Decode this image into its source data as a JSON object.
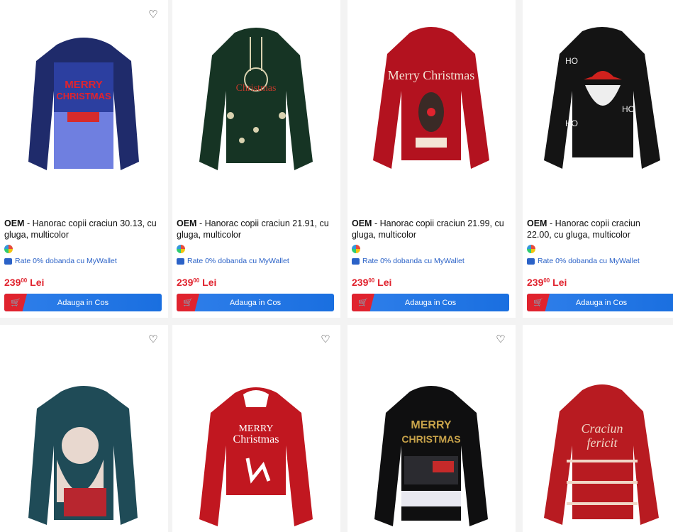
{
  "products_row1": [
    {
      "brand": "OEM",
      "title": "Hanorac copii craciun 30.13, cu gluga, multicolor",
      "rate": "Rate 0% dobanda cu MyWallet",
      "price_int": "239",
      "price_dec": "00",
      "currency": "Lei",
      "button": "Adauga in Cos",
      "colors": {
        "body": "#1f2b6b",
        "print": "#6f7fe0",
        "accent": "#e0232e"
      }
    },
    {
      "brand": "OEM",
      "title": "Hanorac copii craciun 21.91, cu gluga, multicolor",
      "rate": "Rate 0% dobanda cu MyWallet",
      "price_int": "239",
      "price_dec": "00",
      "currency": "Lei",
      "button": "Adauga in Cos",
      "colors": {
        "body": "#163424",
        "print": "#d9d2b0",
        "accent": "#c0392b"
      }
    },
    {
      "brand": "OEM",
      "title": "Hanorac copii craciun 21.99, cu gluga, multicolor",
      "rate": "Rate 0% dobanda cu MyWallet",
      "price_int": "239",
      "price_dec": "00",
      "currency": "Lei",
      "button": "Adauga in Cos",
      "colors": {
        "body": "#b3121f",
        "print": "#f4e5d6",
        "accent": "#3a2a26"
      }
    },
    {
      "brand": "OEM",
      "title": "Hanorac copii craciun 22.00, cu gluga, multicolor",
      "rate": "Rate 0% dobanda cu MyWallet",
      "price_int": "239",
      "price_dec": "00",
      "currency": "Lei",
      "button": "Adauga in Cos",
      "colors": {
        "body": "#141414",
        "print": "#eeeeee",
        "accent": "#d0211d"
      }
    }
  ],
  "products_row2": [
    {
      "colors": {
        "body": "#1f4b57",
        "print": "#e8d8cf",
        "accent": "#b8262f"
      }
    },
    {
      "colors": {
        "body": "#c11720",
        "print": "#ffffff",
        "accent": "#ffffff"
      }
    },
    {
      "colors": {
        "body": "#0f0f10",
        "print": "#c8a34a",
        "accent": "#c52a2a"
      }
    },
    {
      "colors": {
        "body": "#b81b21",
        "print": "#f0d6c6",
        "accent": "#ffffff"
      }
    }
  ],
  "icons": {
    "favorite": "heart-icon",
    "cart": "cart-icon",
    "wallet": "wallet-icon"
  }
}
